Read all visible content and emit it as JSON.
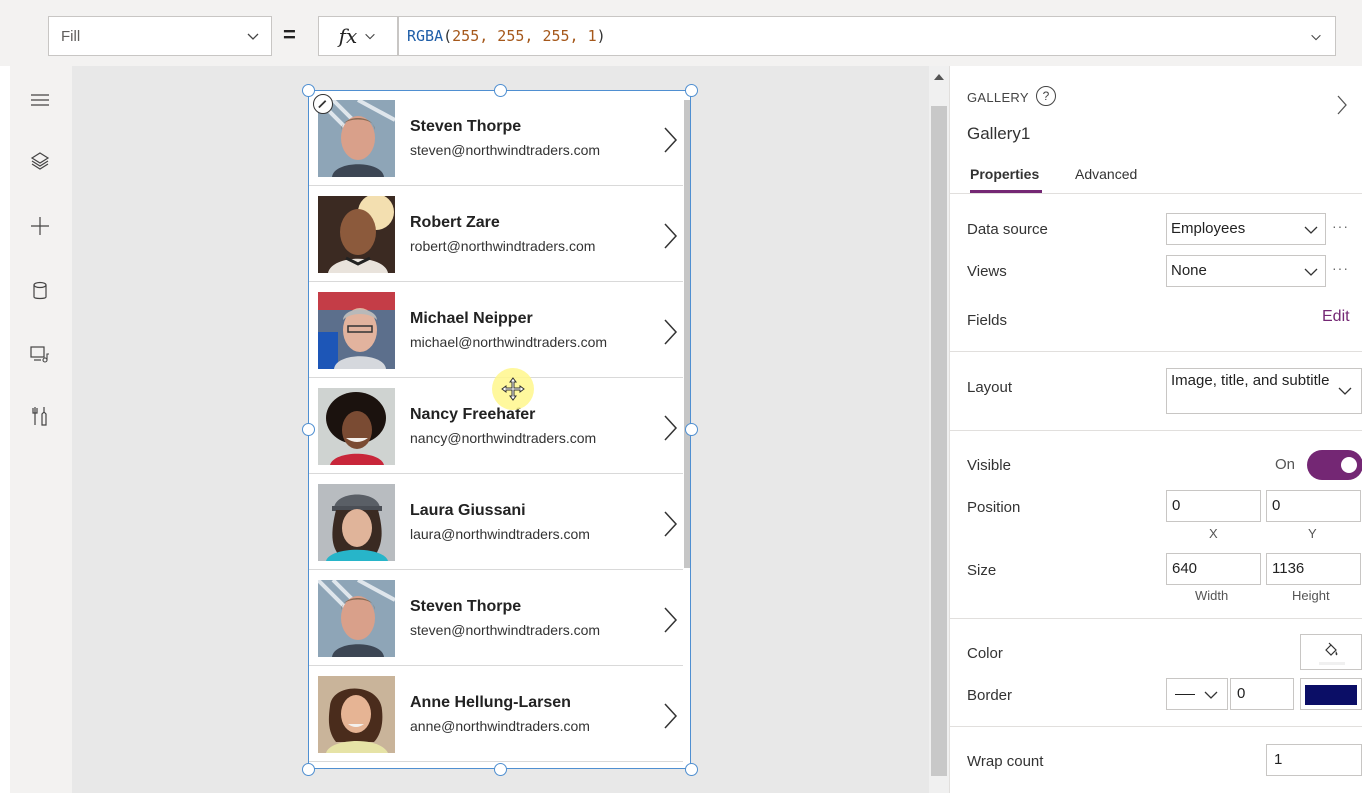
{
  "formula_bar": {
    "property": "Fill",
    "equals": "=",
    "fx_label": "fx",
    "formula_fn": "RGBA",
    "formula_open": "(",
    "formula_args": "255, 255, 255, 1",
    "formula_close": ")"
  },
  "left_rail": {
    "icons": [
      "menu-icon",
      "layers-icon",
      "plus-icon",
      "database-icon",
      "media-icon",
      "tools-icon"
    ]
  },
  "gallery": {
    "items": [
      {
        "name": "Steven Thorpe",
        "email": "steven@northwindtraders.com"
      },
      {
        "name": "Robert Zare",
        "email": "robert@northwindtraders.com"
      },
      {
        "name": "Michael Neipper",
        "email": "michael@northwindtraders.com"
      },
      {
        "name": "Nancy Freehafer",
        "email": "nancy@northwindtraders.com"
      },
      {
        "name": "Laura Giussani",
        "email": "laura@northwindtraders.com"
      },
      {
        "name": "Steven Thorpe",
        "email": "steven@northwindtraders.com"
      },
      {
        "name": "Anne Hellung-Larsen",
        "email": "anne@northwindtraders.com"
      }
    ]
  },
  "panel": {
    "control_type": "GALLERY",
    "help": "?",
    "control_name": "Gallery1",
    "tabs": [
      {
        "label": "Properties"
      },
      {
        "label": "Advanced"
      }
    ],
    "data_source_label": "Data source",
    "data_source_value": "Employees",
    "views_label": "Views",
    "views_value": "None",
    "more": "···",
    "fields_label": "Fields",
    "fields_edit": "Edit",
    "layout_label": "Layout",
    "layout_value": "Image, title, and subtitle",
    "visible_label": "Visible",
    "visible_state": "On",
    "position_label": "Position",
    "position_x": "0",
    "position_y": "0",
    "x_label": "X",
    "y_label": "Y",
    "size_label": "Size",
    "size_width": "640",
    "size_height": "1136",
    "width_label": "Width",
    "height_label": "Height",
    "color_label": "Color",
    "border_label": "Border",
    "border_width": "0",
    "border_color": "#0b0e66",
    "wrap_count_label": "Wrap count",
    "wrap_count_value": "1"
  },
  "colors": {
    "accent": "#742774",
    "selection": "#4f8fd1"
  }
}
